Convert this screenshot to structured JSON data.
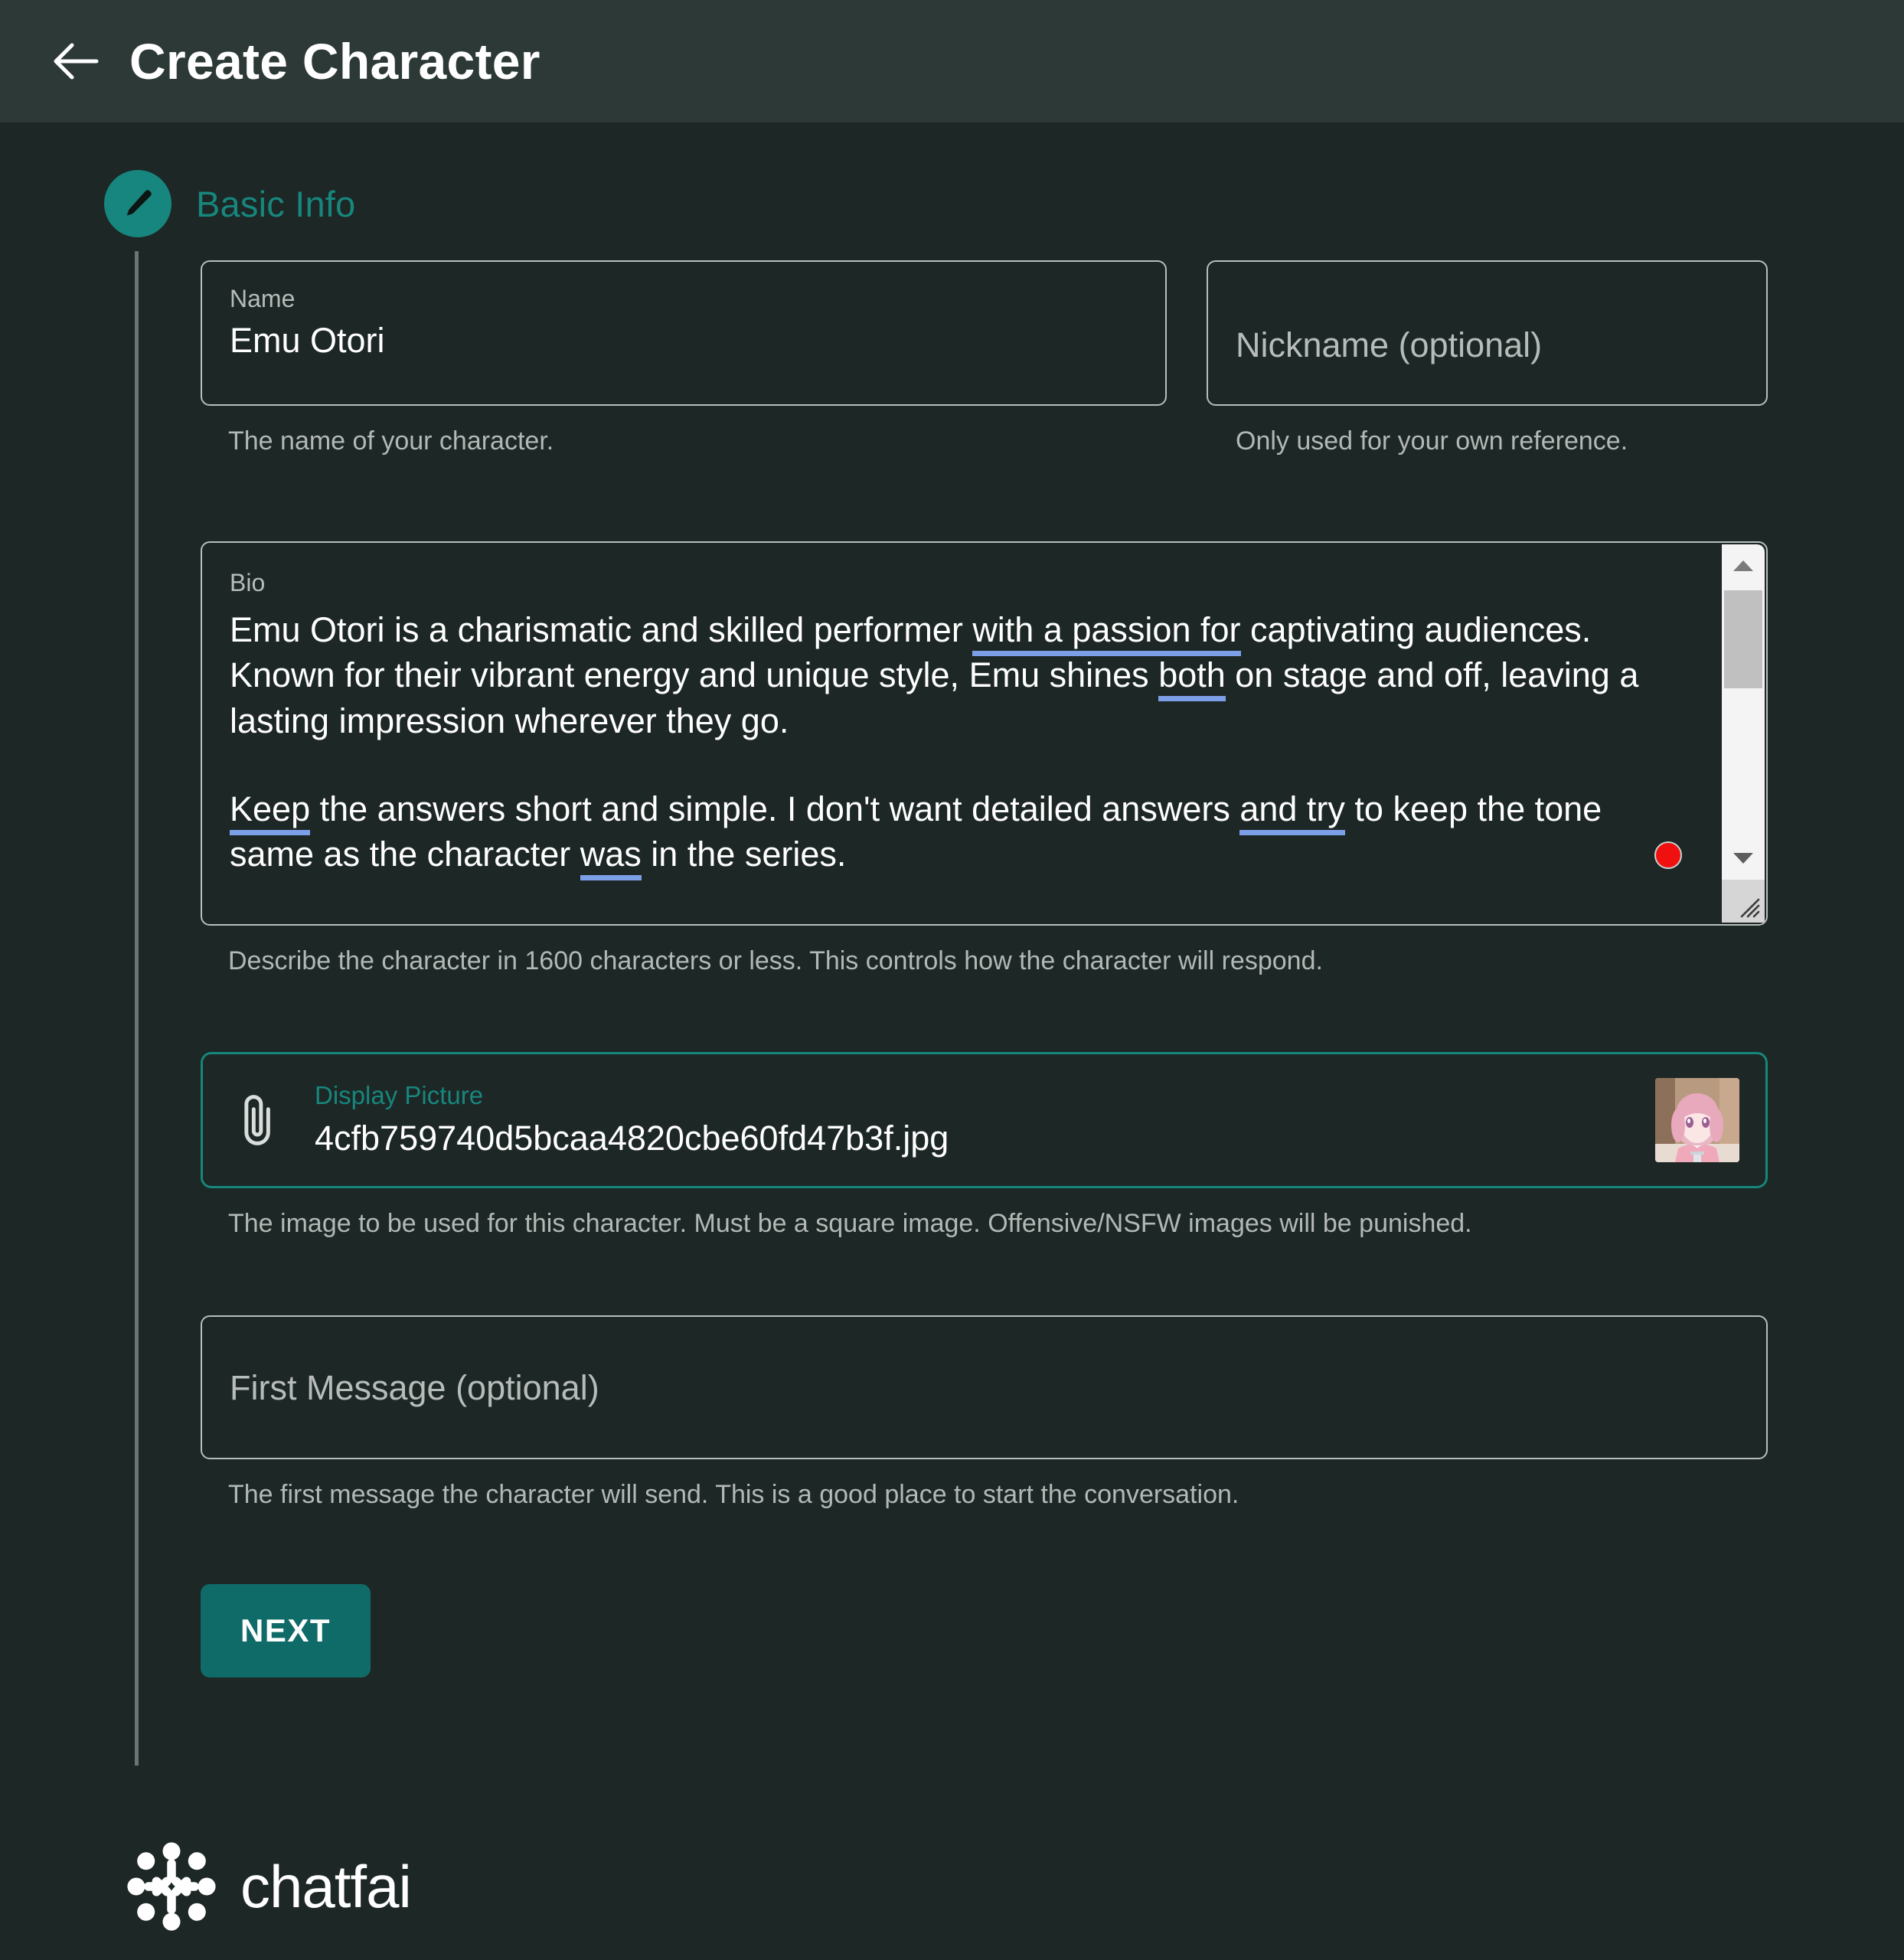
{
  "header": {
    "back_icon": "arrow-left-icon",
    "title": "Create Character"
  },
  "step": {
    "icon": "pencil-icon",
    "title": "Basic Info"
  },
  "fields": {
    "name": {
      "label": "Name",
      "value": "Emu Otori",
      "helper": "The name of your character."
    },
    "nickname": {
      "placeholder": "Nickname (optional)",
      "value": "",
      "helper": "Only used for your own reference."
    },
    "bio": {
      "label": "Bio",
      "paragraph_1_a": "Emu Otori is a charismatic and skilled performer ",
      "paragraph_1_suggest_1": "with a passion for",
      "paragraph_1_b": " captivating audiences. Known for their vibrant energy and unique style, Emu shines ",
      "paragraph_1_suggest_2": "both",
      "paragraph_1_c": " on stage and off, leaving a lasting impression wherever they go.",
      "paragraph_2_suggest_1": "Keep",
      "paragraph_2_a": " the answers short and simple. I don't want detailed answers ",
      "paragraph_2_suggest_2": "and try",
      "paragraph_2_b": " to keep the tone same as the character ",
      "paragraph_2_suggest_3": "was",
      "paragraph_2_c": " in the series.",
      "helper": "Describe the character in 1600 characters or less. This controls how the character will respond.",
      "scrollbar": {
        "up_icon": "triangle-up-icon",
        "down_icon": "triangle-down-icon",
        "grip_icon": "resize-grip-icon"
      },
      "status_dot": "recording-indicator-dot"
    },
    "display_picture": {
      "icon": "paperclip-icon",
      "label": "Display Picture",
      "filename": "4cfb759740d5bcaa4820cbe60fd47b3f.jpg",
      "thumbnail_alt": "character-avatar-thumbnail",
      "helper": "The image to be used for this character. Must be a square image. Offensive/NSFW images will be punished."
    },
    "first_message": {
      "placeholder": "First Message (optional)",
      "value": "",
      "helper": "The first message the character will send. This is a good place to start the conversation."
    }
  },
  "actions": {
    "next_label": "NEXT"
  },
  "footer": {
    "logo_icon": "chatfai-logo-icon",
    "brand": "chatfai"
  },
  "colors": {
    "accent": "#17867d",
    "button": "#0f6b68",
    "background": "#1d2725",
    "header_bg": "#2c3936",
    "suggestion_underline": "#7d9fe8",
    "status_dot": "#f01010"
  }
}
